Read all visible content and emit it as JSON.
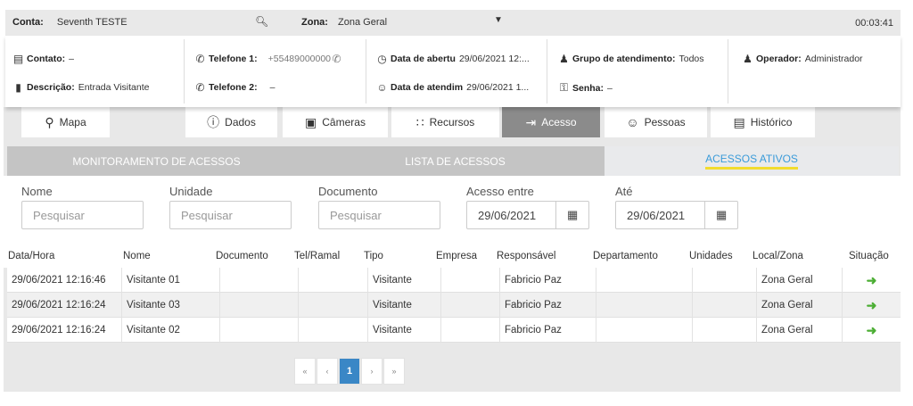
{
  "topbar": {
    "conta_label": "Conta:",
    "conta_value": "Seventh TESTE",
    "zona_label": "Zona:",
    "zona_value": "Zona Geral",
    "timer": "00:03:41"
  },
  "info": {
    "contato_label": "Contato:",
    "contato_value": "–",
    "descricao_label": "Descrição:",
    "descricao_value": "Entrada Visitante",
    "telefone1_label": "Telefone 1:",
    "telefone1_value": "+55489000000",
    "telefone2_label": "Telefone 2:",
    "telefone2_value": "–",
    "data_abertura_label": "Data de abertu",
    "data_abertura_value": "29/06/2021 12:...",
    "data_atendimento_label": "Data de atendim",
    "data_atendimento_value": "29/06/2021 1...",
    "grupo_label": "Grupo de atendimento:",
    "grupo_value": "Todos",
    "senha_label": "Senha:",
    "senha_value": "–",
    "operador_label": "Operador:",
    "operador_value": "Administrador"
  },
  "nav": {
    "mapa": "Mapa",
    "dados": "Dados",
    "cameras": "Câmeras",
    "recursos": "Recursos",
    "acesso": "Acesso",
    "pessoas": "Pessoas",
    "historico": "Histórico"
  },
  "subtabs": {
    "monitoramento": "MONITORAMENTO DE ACESSOS",
    "lista": "LISTA DE ACESSOS",
    "ativos": "ACESSOS ATIVOS"
  },
  "filters": {
    "nome_label": "Nome",
    "nome_placeholder": "Pesquisar",
    "unidade_label": "Unidade",
    "unidade_placeholder": "Pesquisar",
    "documento_label": "Documento",
    "documento_placeholder": "Pesquisar",
    "acesso_entre_label": "Acesso entre",
    "acesso_entre_value": "29/06/2021",
    "ate_label": "Até",
    "ate_value": "29/06/2021"
  },
  "table": {
    "headers": [
      "Data/Hora",
      "Nome",
      "Documento",
      "Tel/Ramal",
      "Tipo",
      "Empresa",
      "Responsável",
      "Departamento",
      "Unidades",
      "Local/Zona",
      "Situação"
    ],
    "rows": [
      {
        "datahora": "29/06/2021 12:16:46",
        "nome": "Visitante 01",
        "documento": "",
        "tel": "",
        "tipo": "Visitante",
        "empresa": "",
        "responsavel": "Fabricio Paz",
        "departamento": "",
        "unidades": "",
        "local": "Zona Geral"
      },
      {
        "datahora": "29/06/2021 12:16:24",
        "nome": "Visitante 03",
        "documento": "",
        "tel": "",
        "tipo": "Visitante",
        "empresa": "",
        "responsavel": "Fabricio Paz",
        "departamento": "",
        "unidades": "",
        "local": "Zona Geral"
      },
      {
        "datahora": "29/06/2021 12:16:24",
        "nome": "Visitante 02",
        "documento": "",
        "tel": "",
        "tipo": "Visitante",
        "empresa": "",
        "responsavel": "Fabricio Paz",
        "departamento": "",
        "unidades": "",
        "local": "Zona Geral"
      }
    ]
  },
  "pager": {
    "first": "«",
    "prev": "‹",
    "current": "1",
    "next": "›",
    "last": "»"
  },
  "colors": {
    "accent": "#3a87c6",
    "active_tab_text": "#3a9bd9",
    "underline": "#f2dc2e",
    "status_icon": "#4cae34"
  }
}
